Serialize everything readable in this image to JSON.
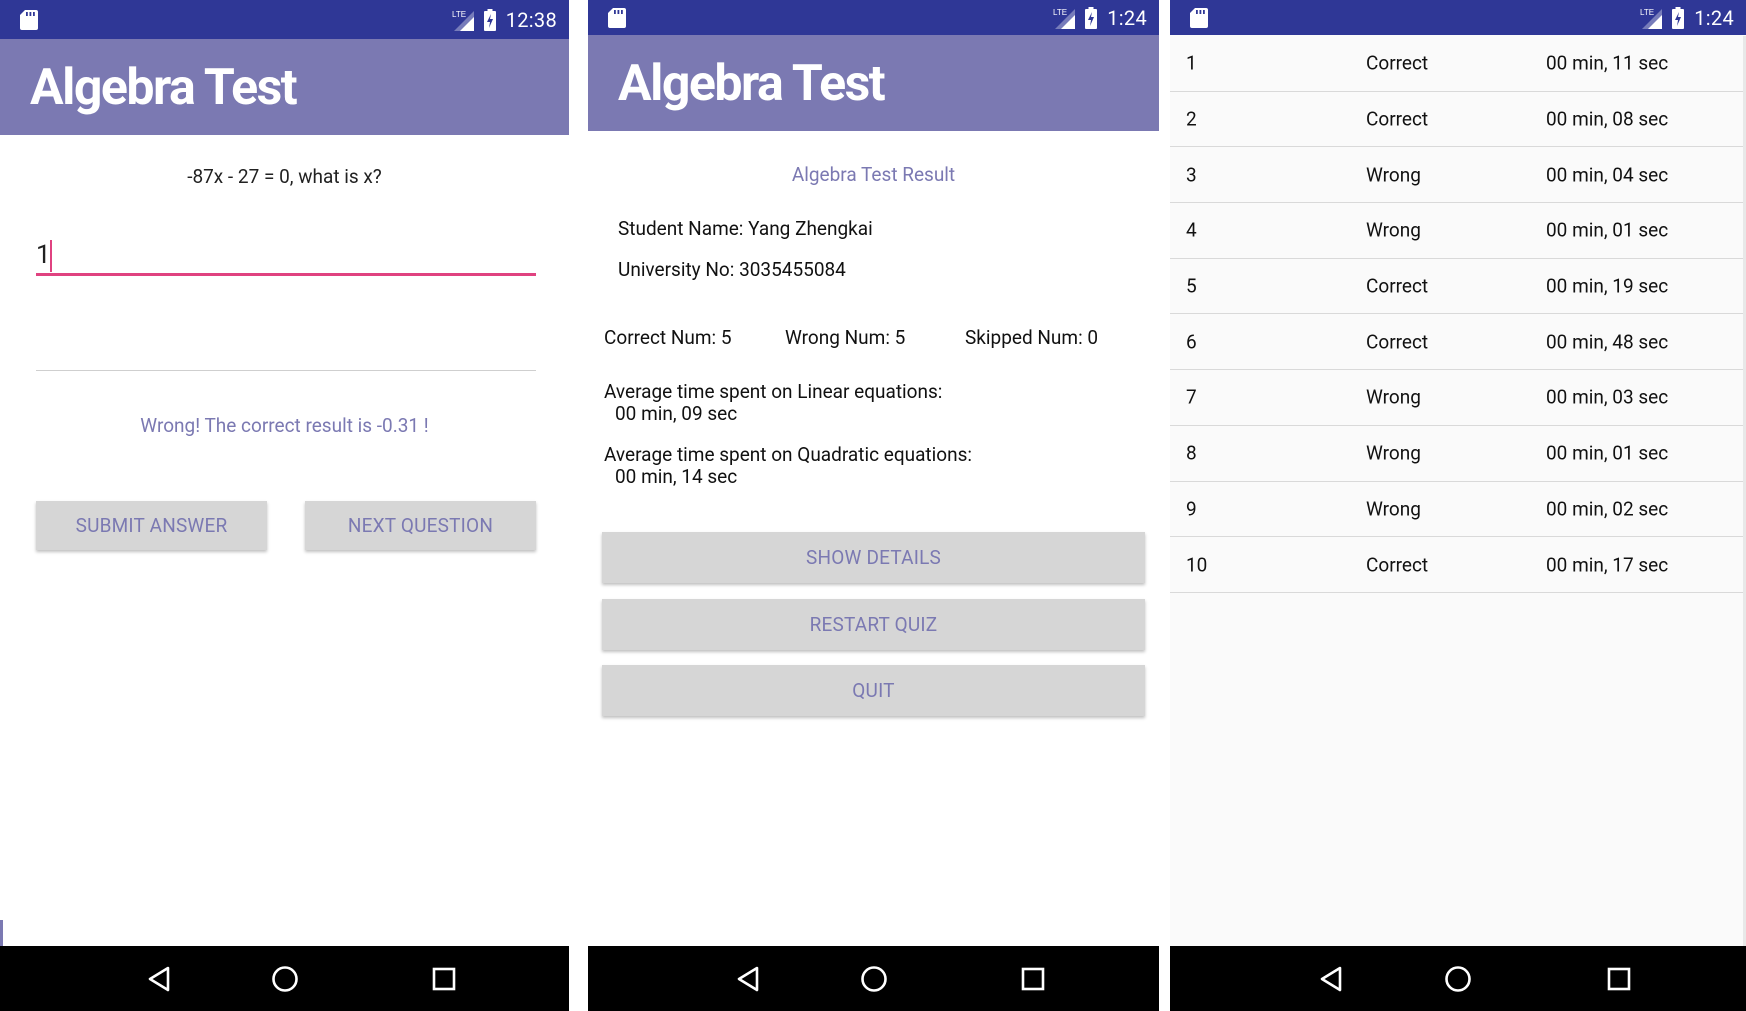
{
  "phones": [
    {
      "status": {
        "time": "12:38",
        "network": "LTE"
      },
      "app_title": "Algebra Test",
      "question": "-87x - 27 = 0, what is x?",
      "answer_value": "1",
      "feedback": "Wrong! The correct result is -0.31 !",
      "buttons": {
        "submit": "SUBMIT ANSWER",
        "next": "NEXT QUESTION"
      }
    },
    {
      "status": {
        "time": "1:24",
        "network": "LTE"
      },
      "app_title": "Algebra Test",
      "result_title": "Algebra Test Result",
      "student_name": "Student Name: Yang Zhengkai",
      "university_no": "University No: 3035455084",
      "correct_num": "Correct Num: 5",
      "wrong_num": "Wrong Num: 5",
      "skipped_num": "Skipped Num: 0",
      "avg_linear_label": "Average time spent on Linear equations:",
      "avg_linear_value": "00 min, 09 sec",
      "avg_quad_label": "Average time spent on Quadratic equations:",
      "avg_quad_value": "00 min, 14 sec",
      "buttons": {
        "details": "SHOW DETAILS",
        "restart": "RESTART QUIZ",
        "quit": "QUIT"
      }
    },
    {
      "status": {
        "time": "1:24",
        "network": "LTE"
      },
      "rows": [
        {
          "num": "1",
          "result": "Correct",
          "time": "00 min, 11 sec"
        },
        {
          "num": "2",
          "result": "Correct",
          "time": "00 min, 08 sec"
        },
        {
          "num": "3",
          "result": "Wrong",
          "time": "00 min, 04 sec"
        },
        {
          "num": "4",
          "result": "Wrong",
          "time": "00 min, 01 sec"
        },
        {
          "num": "5",
          "result": "Correct",
          "time": "00 min, 19 sec"
        },
        {
          "num": "6",
          "result": "Correct",
          "time": "00 min, 48 sec"
        },
        {
          "num": "7",
          "result": "Wrong",
          "time": "00 min, 03 sec"
        },
        {
          "num": "8",
          "result": "Wrong",
          "time": "00 min, 01 sec"
        },
        {
          "num": "9",
          "result": "Wrong",
          "time": "00 min, 02 sec"
        },
        {
          "num": "10",
          "result": "Correct",
          "time": "00 min, 17 sec"
        }
      ]
    }
  ],
  "colors": {
    "status_bar": "#2f3796",
    "app_bar": "#7b79b2",
    "accent_text": "#7b79b2",
    "input_underline": "#e04280",
    "button_bg": "#d6d6d6",
    "nav_bar": "#000000"
  },
  "icons": {
    "status_left": "sd-card-icon",
    "status_signal": "lte-signal-icon",
    "status_battery": "battery-icon",
    "nav": [
      "back-icon",
      "home-icon",
      "recents-icon"
    ]
  }
}
